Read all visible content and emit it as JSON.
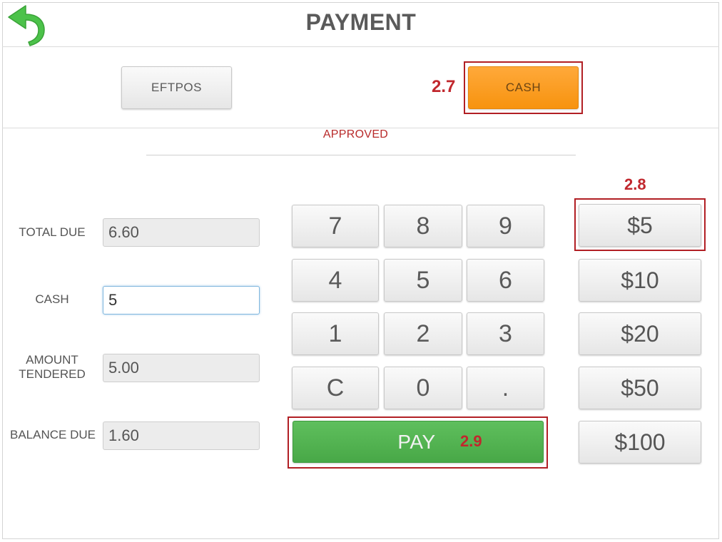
{
  "header": {
    "title": "PAYMENT",
    "back_icon": "back-arrow-icon"
  },
  "tabs": {
    "eftpos_label": "EFTPOS",
    "cash_label": "CASH"
  },
  "status": {
    "text": "APPROVED"
  },
  "fields": {
    "total_due_label": "TOTAL DUE",
    "total_due_value": "6.60",
    "cash_label": "CASH",
    "cash_value": "5",
    "amount_tendered_label_line1": "AMOUNT",
    "amount_tendered_label_line2": "TENDERED",
    "amount_tendered_value": "5.00",
    "balance_due_label": "BALANCE DUE",
    "balance_due_value": "1.60"
  },
  "keypad": {
    "rows": [
      [
        "7",
        "8",
        "9"
      ],
      [
        "4",
        "5",
        "6"
      ],
      [
        "1",
        "2",
        "3"
      ],
      [
        "C",
        "0",
        "."
      ]
    ]
  },
  "quick_amounts": [
    "$5",
    "$10",
    "$20",
    "$50",
    "$100"
  ],
  "pay": {
    "label": "PAY"
  },
  "annotations": {
    "cash_marker": "2.7",
    "quick_marker": "2.8",
    "pay_marker": "2.9"
  },
  "colors": {
    "cash_button": "#f7930f",
    "pay_button": "#4cad4b",
    "status_text": "#b82a2a",
    "annotation_red": "#c1272d",
    "back_arrow": "#4cc24a"
  }
}
